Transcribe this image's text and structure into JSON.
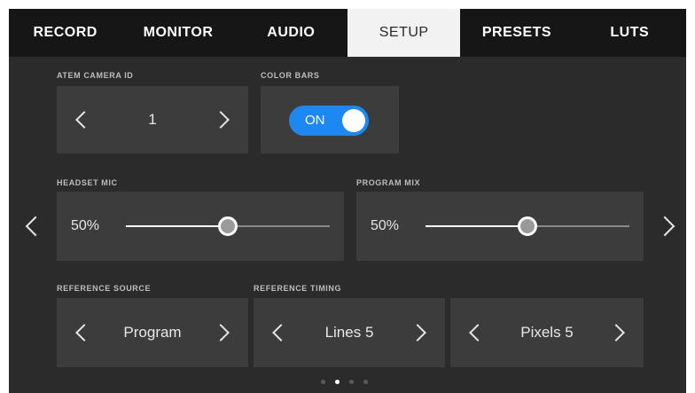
{
  "tabs": [
    {
      "label": "RECORD",
      "active": false
    },
    {
      "label": "MONITOR",
      "active": false
    },
    {
      "label": "AUDIO",
      "active": false
    },
    {
      "label": "SETUP",
      "active": true
    },
    {
      "label": "PRESETS",
      "active": false
    },
    {
      "label": "LUTS",
      "active": false
    }
  ],
  "atem_camera_id": {
    "label": "ATEM CAMERA ID",
    "value": "1"
  },
  "color_bars": {
    "label": "COLOR BARS",
    "state": "ON",
    "accent": "#1e88f2"
  },
  "headset_mic": {
    "label": "HEADSET MIC",
    "value_text": "50%",
    "level": 0.5
  },
  "program_mix": {
    "label": "PROGRAM MIX",
    "value_text": "50%",
    "level": 0.5
  },
  "reference_source": {
    "label": "REFERENCE SOURCE",
    "value": "Program"
  },
  "reference_timing": {
    "label": "REFERENCE TIMING",
    "lines": "Lines 5",
    "pixels": "Pixels 5"
  },
  "pagination": {
    "pages": 4,
    "current": 2
  },
  "icons": {
    "prev": "chevron-left-icon",
    "next": "chevron-right-icon"
  }
}
